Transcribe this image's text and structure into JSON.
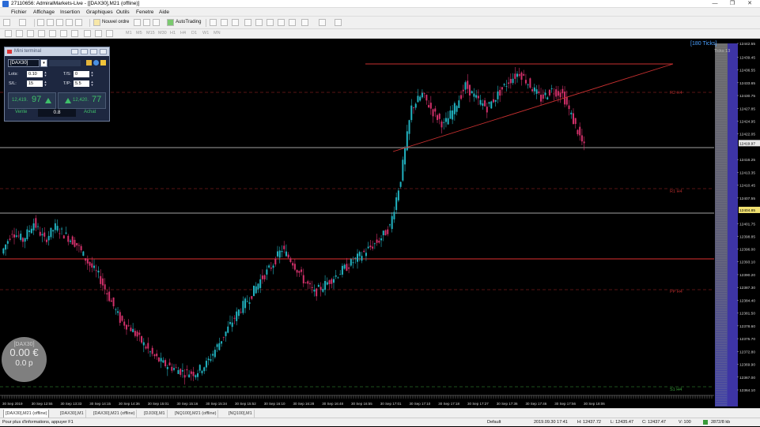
{
  "window": {
    "title": "27110656: AdmiralMarkets-Live - [[DAX30],M21 (offline)]",
    "controls": [
      "—",
      "❐",
      "✕"
    ]
  },
  "menu": [
    "Fichier",
    "Affichage",
    "Insertion",
    "Graphiques",
    "Outils",
    "Fenetre",
    "Aide"
  ],
  "toolbar": {
    "new_order_label": "Nouvel ordre",
    "autotrading_label": "AutoTrading",
    "timeframes": [
      "M1",
      "M5",
      "M15",
      "M30",
      "H1",
      "H4",
      "D1",
      "W1",
      "MN"
    ]
  },
  "mini_terminal": {
    "title": "Mini terminal",
    "symbol": "[DAX30]",
    "lots_label": "Lots:",
    "lots_value": "0.10",
    "ts_label": "T/S:",
    "ts_value": "0",
    "sl_label": "S/L:",
    "sl_value": "15",
    "tp_label": "T/P:",
    "tp_value": "5.5",
    "bid_small": "12,419.",
    "bid_big": "97",
    "ask_small": "12,420.",
    "ask_big": "77",
    "sell_label": "Vente",
    "buy_label": "Achat",
    "spread": "0.8"
  },
  "chart": {
    "ticks_badge": "[180 Ticks]",
    "ticks_label": "Ticks 13",
    "balance_symbol": "[DAX30]",
    "balance_amount": "0.00 €",
    "balance_points": "0.0 p",
    "level_labels": [
      "R2 H4",
      "R1 H4",
      "PP H4",
      "S1 H4"
    ],
    "price_labels": [
      "12442.55",
      "12439.45",
      "12436.55",
      "12433.65",
      "12430.75",
      "12427.85",
      "12424.95",
      "12422.05",
      "12419.97",
      "12416.25",
      "12413.35",
      "12410.45",
      "12407.55",
      "12404.85",
      "12401.75",
      "12398.85",
      "12396.00",
      "12393.10",
      "12390.20",
      "12387.30",
      "12384.40",
      "12381.50",
      "12378.60",
      "12375.70",
      "12372.80",
      "12369.90",
      "12367.00",
      "12364.10"
    ],
    "highlighted_prices": [
      "12419.97",
      "12404.85"
    ],
    "time_labels": [
      "30 Sep 2019",
      "30 Sep 12:55",
      "30 Sep 13:33",
      "30 Sep 14:15",
      "30 Sep 14:36",
      "30 Sep 15:01",
      "30 Sep 15:16",
      "30 Sep 15:34",
      "30 Sep 15:52",
      "30 Sep 16:10",
      "30 Sep 16:28",
      "30 Sep 16:48",
      "30 Sep 16:55",
      "30 Sep 17:01",
      "30 Sep 17:10",
      "30 Sep 17:18",
      "30 Sep 17:27",
      "30 Sep 17:36",
      "30 Sep 17:46",
      "30 Sep 17:56",
      "30 Sep 18:06"
    ]
  },
  "tabs": [
    "[DAX30],M21 (offline)",
    "[DAX30],M1",
    "[DAX30],M21 (offline)",
    "[DJI30],M1",
    "[NQ100],M21 (offline)",
    "[NQ100],M1"
  ],
  "status": {
    "help": "Pour plus d'informations, appuyer F1",
    "profile": "Default",
    "datetime": "2019.09.30 17:41",
    "high": "H: 12437.72",
    "low": "L: 12435.47",
    "close": "C: 12437.47",
    "volume": "V: 100",
    "traffic": "2872/8 kb"
  },
  "chart_data": {
    "type": "candlestick",
    "ylim": [
      12364.1,
      12442.55
    ],
    "series": [
      {
        "values": [
          12395,
          12400,
          12398,
          12402,
          12398,
          12401,
          12399,
          12397,
          12393,
          12390,
          12385,
          12380,
          12378,
          12375,
          12372,
          12370,
          12369,
          12368,
          12368,
          12370,
          12374,
          12378,
          12382,
          12385,
          12389,
          12392,
          12396,
          12393,
          12389,
          12386,
          12388,
          12390,
          12392,
          12394,
          12396,
          12398,
          12401,
          12412,
          12428,
          12431,
          12427,
          12424,
          12428,
          12433,
          12430,
          12428,
          12431,
          12434,
          12436,
          12433,
          12430,
          12432,
          12431,
          12425,
          12419
        ]
      }
    ]
  }
}
